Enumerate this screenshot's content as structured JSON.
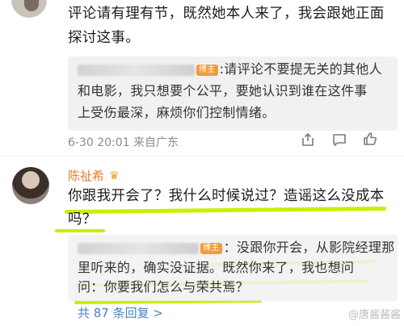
{
  "top_comment": {
    "line1": "评论请有理有节，既然她本人来了，我会跟她正面",
    "line2": "探讨这事。",
    "reply": {
      "badge": "博主",
      "line1": ":请评论不要提无关的其他人",
      "line2": "和电影，我只想要个公平，要她认识到谁在这件事",
      "line3": "上受伤最深，麻烦你们控制情绪。"
    },
    "meta": "6-30 20:01 来自广东"
  },
  "main_comment": {
    "name": "陈祉希",
    "vip_icon": "crown-icon",
    "line1": "你跟我开会了？我什么时候说过？造谣这么没成本",
    "line2": "吗？",
    "reply": {
      "badge": "博主",
      "line1": "：没跟你开会，从影院经理那",
      "line2": "里听来的，确实没证据。既然你来了，我也想问",
      "line3": "问：你要我们怎么与荣共焉？"
    },
    "more_replies": "共 87 条回复 >"
  },
  "watermark": "@唐酱酱酱"
}
